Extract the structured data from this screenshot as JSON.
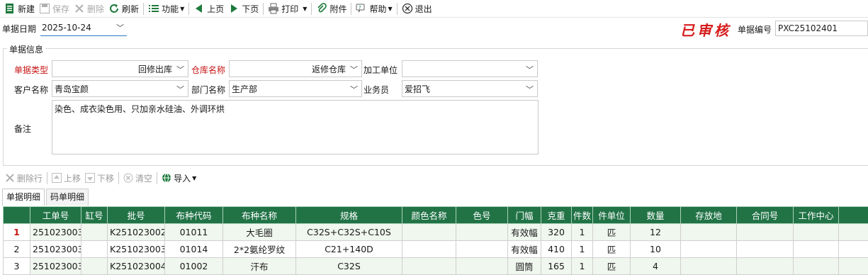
{
  "toolbar": {
    "new": "新建",
    "save": "保存",
    "delete": "删除",
    "refresh": "刷新",
    "function": "功能",
    "prev": "上页",
    "next": "下页",
    "print": "打印",
    "attach": "附件",
    "help": "帮助",
    "exit": "退出"
  },
  "header": {
    "date_label": "单据日期",
    "date_value": "2025-10-24",
    "status": "已审核",
    "billno_label": "单据编号",
    "billno_value": "PXC25102401"
  },
  "info": {
    "group_title": "单据信息",
    "bill_type_label": "单据类型",
    "bill_type_value": "回修出库",
    "warehouse_label": "仓库名称",
    "warehouse_value": "返修仓库",
    "processing_unit_label": "加工单位",
    "processing_unit_value": "",
    "customer_label": "客户名称",
    "customer_value": "青岛宝颜",
    "dept_label": "部门名称",
    "dept_value": "生产部",
    "salesman_label": "业务员",
    "salesman_value": "爱招飞",
    "memo_label": "备注",
    "memo_value": "染色、成衣染色用、只加亲水硅油、外调环烘"
  },
  "detail_toolbar": {
    "delete_row": "删除行",
    "move_up": "上移",
    "move_down": "下移",
    "clear": "清空",
    "import": "导入"
  },
  "tabs": [
    "单据明细",
    "码单明细"
  ],
  "grid": {
    "columns": [
      "",
      "工单号",
      "缸号",
      "批号",
      "布种代码",
      "布种名称",
      "规格",
      "颜色名称",
      "色号",
      "门幅",
      "克重",
      "件数",
      "件单位",
      "数量",
      "存放地",
      "合同号",
      "工作中心",
      ""
    ],
    "rows": [
      {
        "n": "1",
        "cells": [
          "251023003",
          "",
          "K251023002",
          "01011",
          "大毛圈",
          "C32S+C32S+C10S",
          "",
          "",
          "有效幅",
          "320",
          "1",
          "匹",
          "12",
          "",
          "",
          "",
          ""
        ]
      },
      {
        "n": "2",
        "cells": [
          "251023003",
          "",
          "K251023003",
          "01014",
          "2*2氨纶罗纹",
          "C21+140D",
          "",
          "",
          "有效幅",
          "410",
          "1",
          "匹",
          "10",
          "",
          "",
          "",
          ""
        ]
      },
      {
        "n": "3",
        "cells": [
          "251023003",
          "",
          "K251023004",
          "01002",
          "汗布",
          "C32S",
          "",
          "",
          "圆筒",
          "165",
          "1",
          "匹",
          "4",
          "",
          "",
          "",
          ""
        ]
      }
    ]
  },
  "colors": {
    "grid_header": "#217346",
    "status_red": "#d61c1c",
    "required_label": "#c81414"
  }
}
